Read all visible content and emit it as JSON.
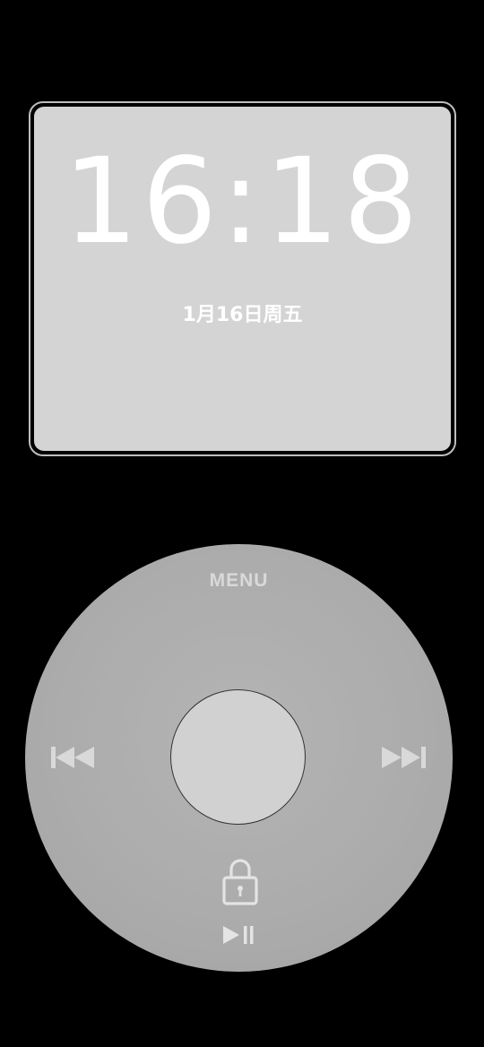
{
  "clock": {
    "time": "16:18",
    "date": "1月16日周五"
  },
  "wheel": {
    "menu_label": "MENU",
    "icons": {
      "previous": "previous-track-icon",
      "next": "next-track-icon",
      "lock": "lock-icon",
      "play_pause": "play-pause-icon"
    }
  },
  "colors": {
    "background": "#000000",
    "screen": "#d4d4d4",
    "wheel": "#acacac",
    "center_button": "#d1d1d1",
    "label": "#d9d9d9"
  }
}
